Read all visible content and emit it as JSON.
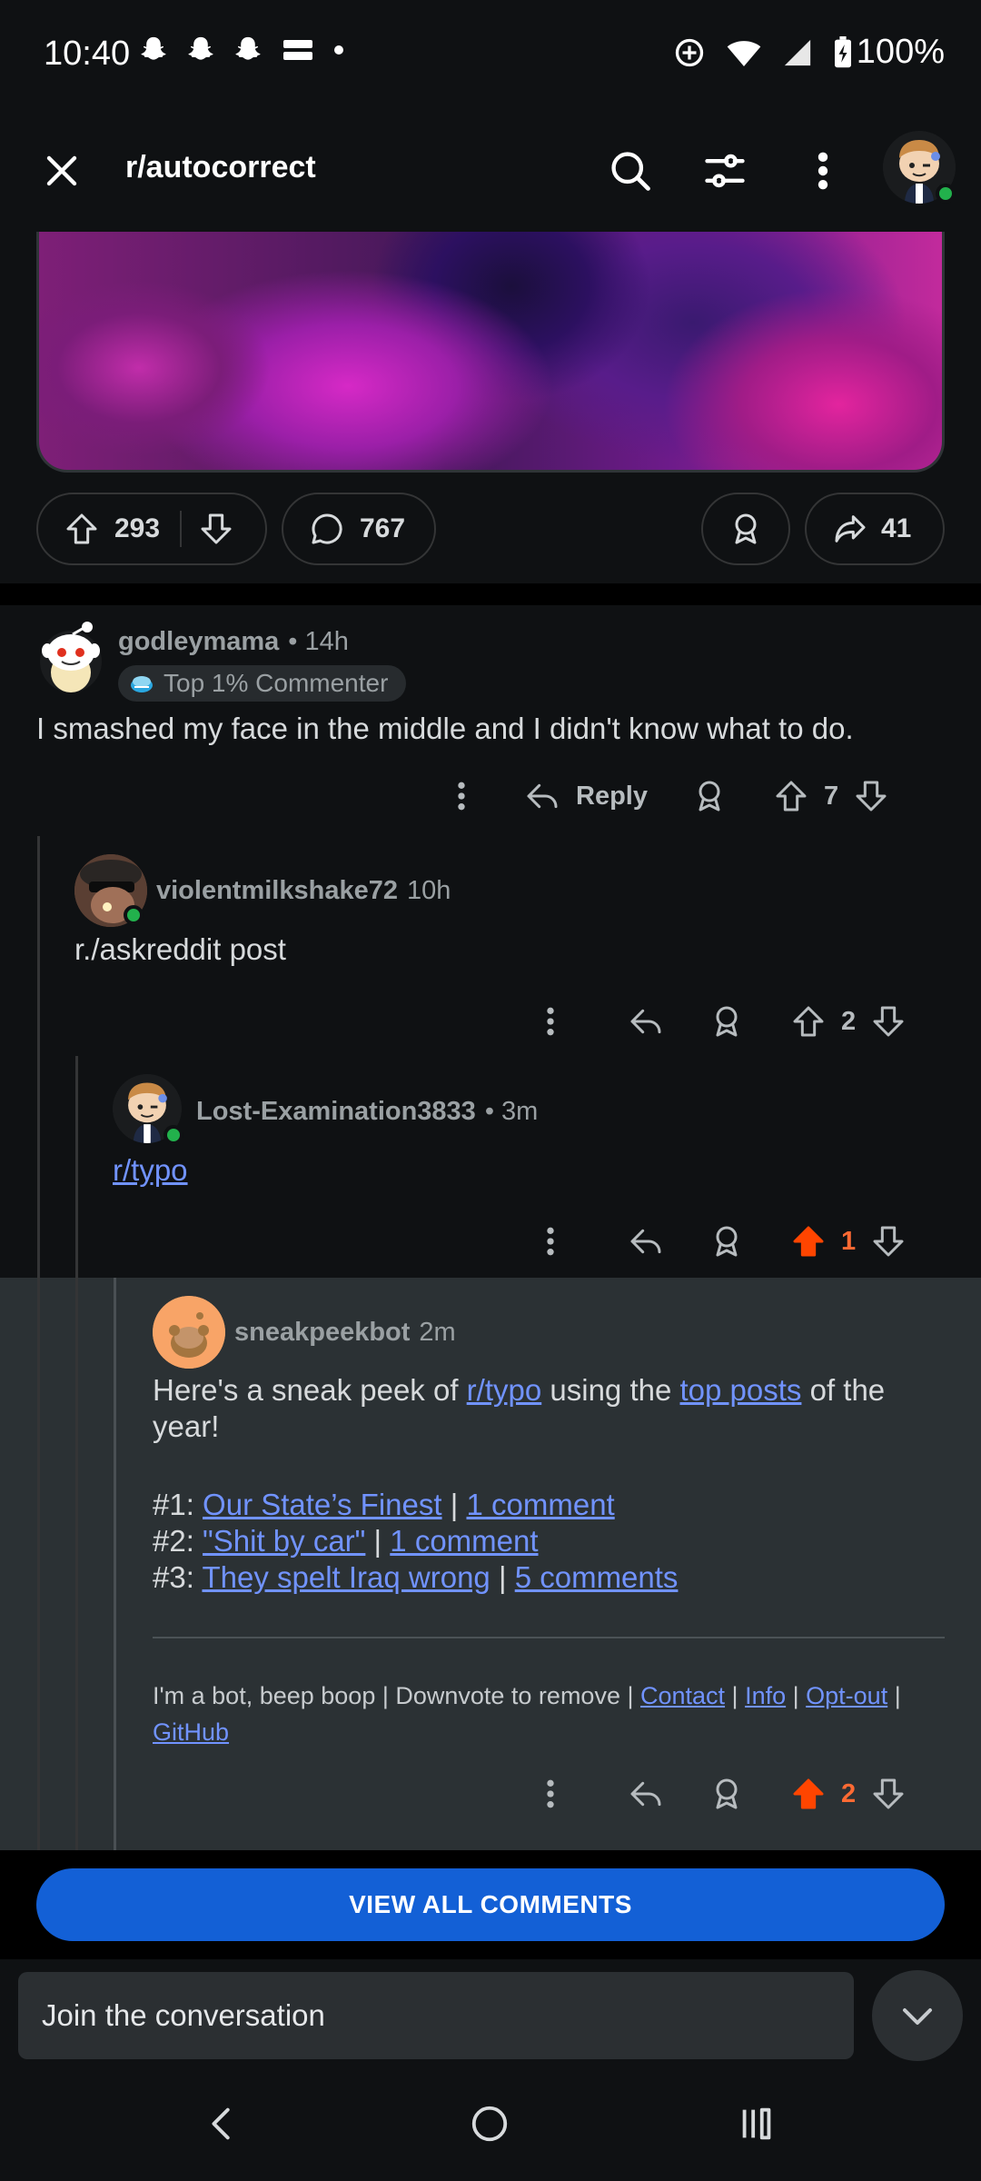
{
  "status_bar": {
    "time": "10:40",
    "battery": "100%",
    "notification_icons": [
      "snapchat-icon",
      "snapchat-icon",
      "snapchat-icon",
      "temu-icon",
      "dot-icon"
    ]
  },
  "app_bar": {
    "title": "r/autocorrect"
  },
  "post_actions": {
    "upvotes": "293",
    "comments": "767",
    "shares": "41"
  },
  "comments": [
    {
      "username": "godleymama",
      "time": "• 14h",
      "badge": "Top 1% Commenter",
      "body": "I smashed my face in the middle and I didn't know what to do.",
      "reply_label": "Reply",
      "votes": "7"
    },
    {
      "username": "violentmilkshake72",
      "time": "10h",
      "body": "r./askreddit post",
      "votes": "2"
    },
    {
      "username": "Lost-Examination3833",
      "time": "• 3m",
      "body_link": "r/typo",
      "votes": "1"
    },
    {
      "username": "sneakpeekbot",
      "time": "2m",
      "intro_1": "Here's a sneak peek of ",
      "intro_link_1": "r/typo",
      "intro_2": " using the ",
      "intro_link_2": "top posts",
      "intro_3": " of the year!",
      "list": [
        {
          "num": "#1: ",
          "title": "Our State’s Finest",
          "sep": " | ",
          "comments": "1 comment"
        },
        {
          "num": "#2: ",
          "title": "\"Shit by car\"",
          "sep": " | ",
          "comments": "1 comment"
        },
        {
          "num": "#3: ",
          "title": "They spelt Iraq wrong",
          "sep": " | ",
          "comments": "5 comments"
        }
      ],
      "footer_text": "I'm a bot, beep boop | Downvote to remove | ",
      "footer_links": [
        "Contact",
        "Info",
        "Opt-out",
        "GitHub"
      ],
      "footer_sep": " | ",
      "votes": "2"
    }
  ],
  "view_all_label": "VIEW ALL COMMENTS",
  "compose_placeholder": "Join the conversation",
  "colors": {
    "background": "#0f1113",
    "accent_blue": "#1360d6",
    "link": "#7193ff",
    "upvoted": "#ff4500",
    "online": "#22b14c"
  }
}
